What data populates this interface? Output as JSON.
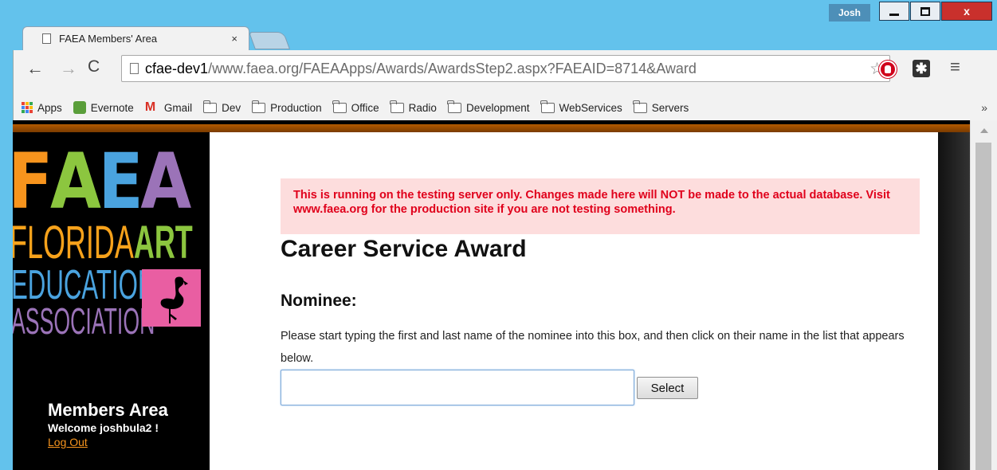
{
  "window": {
    "user_name": "Josh",
    "close_glyph": "x"
  },
  "tab": {
    "title": "FAEA Members' Area",
    "close_glyph": "×"
  },
  "toolbar": {
    "url_host": "cfae-dev1",
    "url_path": "/www.faea.org/FAEAApps/Awards/AwardsStep2.aspx?FAEAID=8714&Award",
    "back_glyph": "←",
    "forward_glyph": "→",
    "reload_glyph": "C",
    "star_glyph": "☆",
    "ext_glyph": "✱",
    "menu_glyph": "≡"
  },
  "bookmarks": {
    "items": [
      {
        "label": "Apps",
        "icon": "apps-grid-icon"
      },
      {
        "label": "Evernote",
        "icon": "evernote-icon"
      },
      {
        "label": "Gmail",
        "icon": "gmail-icon"
      },
      {
        "label": "Dev",
        "icon": "folder-icon"
      },
      {
        "label": "Production",
        "icon": "folder-icon"
      },
      {
        "label": "Office",
        "icon": "folder-icon"
      },
      {
        "label": "Radio",
        "icon": "folder-icon"
      },
      {
        "label": "Development",
        "icon": "folder-icon"
      },
      {
        "label": "WebServices",
        "icon": "folder-icon"
      },
      {
        "label": "Servers",
        "icon": "folder-icon"
      }
    ],
    "more": "»"
  },
  "logo": {
    "letters": [
      "F",
      "A",
      "E",
      "A"
    ],
    "letter_colors": [
      "#f7941d",
      "#8cc63f",
      "#4aa3df",
      "#9b73b8"
    ],
    "florida": "FLORIDA",
    "art": "ART",
    "education": "EDUCATION",
    "association": "ASSOCIATION"
  },
  "sidebar": {
    "members_title": "Members Area",
    "welcome_prefix": "Welcome ",
    "username": "joshbula2",
    "welcome_suffix": " !",
    "logout": "Log Out"
  },
  "main": {
    "warning": "This is running on the testing server only. Changes made here will NOT be made to the actual database. Visit www.faea.org for the production site if you are not testing something.",
    "title": "Career Service Award",
    "section": "Nominee:",
    "instructions": "Please start typing the first and last name of the nominee into this box, and then click on their name in the list that appears below.",
    "nominee_value": "",
    "select_label": "Select"
  },
  "colors": {
    "accent_orange": "#f7941d",
    "warning_bg": "#fddddd",
    "warning_text": "#e0001b"
  }
}
